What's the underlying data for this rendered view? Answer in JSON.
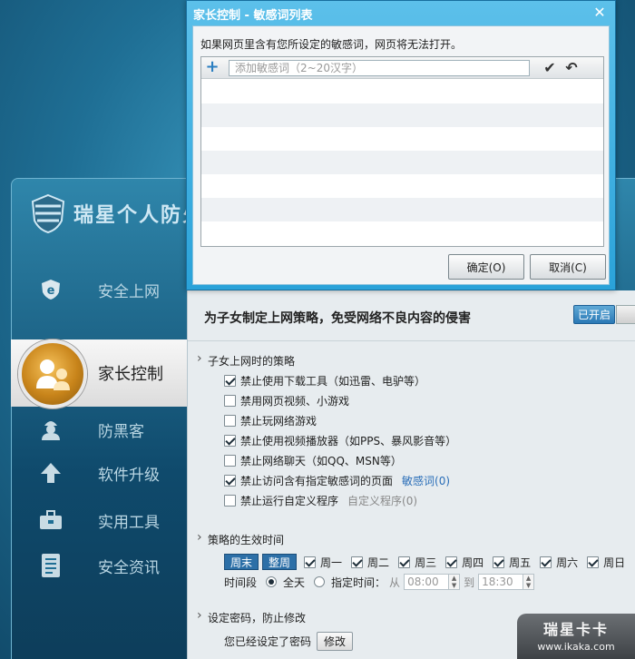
{
  "app": {
    "title": "瑞星个人防火",
    "nav": [
      {
        "label": "安全上网",
        "icon": "ie-shield-icon"
      },
      {
        "label": "家长控制",
        "icon": "parents-icon",
        "active": true
      },
      {
        "label": "防黑客",
        "icon": "hacker-icon"
      },
      {
        "label": "软件升级",
        "icon": "upload-arrow-icon"
      },
      {
        "label": "实用工具",
        "icon": "toolbox-icon"
      },
      {
        "label": "安全资讯",
        "icon": "document-icon"
      }
    ]
  },
  "panel": {
    "heading": "为子女制定上网策略，免受网络不良内容的侵害",
    "toggle_label": "已开启",
    "policy_section": "子女上网时的策略",
    "policies": [
      {
        "label": "禁止使用下载工具（如迅雷、电驴等）",
        "checked": true
      },
      {
        "label": "禁用网页视频、小游戏",
        "checked": false
      },
      {
        "label": "禁止玩网络游戏",
        "checked": false
      },
      {
        "label": "禁止使用视频播放器（如PPS、暴风影音等）",
        "checked": true
      },
      {
        "label": "禁止网络聊天（如QQ、MSN等）",
        "checked": false
      },
      {
        "label": "禁止访问含有指定敏感词的页面",
        "checked": true,
        "link": "敏感词(0)"
      },
      {
        "label": "禁止运行自定义程序",
        "checked": false,
        "muted_link": "自定义程序(0)"
      }
    ],
    "time_section": "策略的生效时间",
    "weekend_btn": "周末",
    "week_btn": "整周",
    "days": [
      "周一",
      "周二",
      "周三",
      "周四",
      "周五",
      "周六",
      "周日"
    ],
    "period_label": "时间段",
    "allday_label": "全天",
    "specified_label": "指定时间：",
    "from_label": "从",
    "to_label": "到",
    "start_time": "08:00",
    "end_time": "18:30",
    "password_section": "设定密码，防止修改",
    "password_status": "您已经设定了密码",
    "modify_btn": "修改"
  },
  "dialog": {
    "title": "家长控制 - 敏感词列表",
    "description": "如果网页里含有您所设定的敏感词，网页将无法打开。",
    "input_placeholder": "添加敏感词（2~20汉字）",
    "ok_label": "确定(O)",
    "cancel_label": "取消(C)"
  },
  "watermark": {
    "line1": "瑞星卡卡",
    "line2": "www.ikaka.com"
  },
  "colors": {
    "accent": "#2aa2d9",
    "link": "#2a6eb8"
  }
}
